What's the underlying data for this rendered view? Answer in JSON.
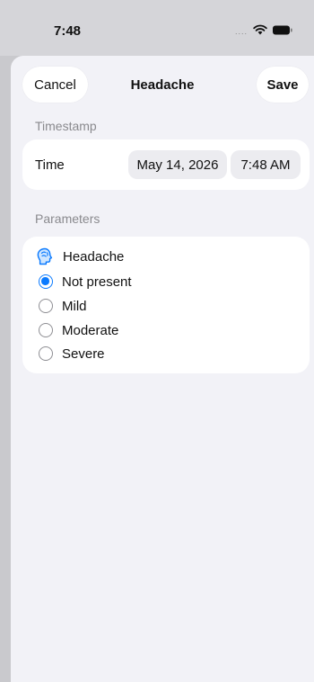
{
  "status_bar": {
    "time": "7:48",
    "signal_dots": "....",
    "wifi_icon": "wifi-icon",
    "battery_icon": "battery-icon"
  },
  "nav": {
    "cancel_label": "Cancel",
    "title": "Headache",
    "save_label": "Save"
  },
  "timestamp_section": {
    "header": "Timestamp",
    "time_label": "Time",
    "date_value": "May 14, 2026",
    "time_value": "7:48 AM"
  },
  "parameters_section": {
    "header": "Parameters",
    "parameter_name": "Headache",
    "parameter_icon": "head-icon",
    "options": [
      {
        "label": "Not present",
        "selected": true
      },
      {
        "label": "Mild",
        "selected": false
      },
      {
        "label": "Moderate",
        "selected": false
      },
      {
        "label": "Severe",
        "selected": false
      }
    ]
  },
  "colors": {
    "accent": "#0a7aff",
    "background": "#f2f2f7",
    "card": "#ffffff"
  }
}
